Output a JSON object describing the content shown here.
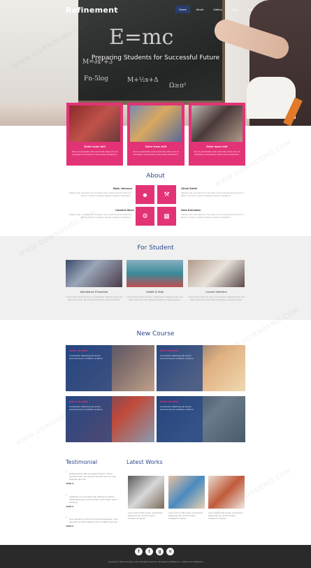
{
  "header": {
    "brand": "Refinement",
    "nav": [
      "Home",
      "About",
      "Gallery",
      "Typo",
      "Mail"
    ],
    "tagline": "Preparing Students for Successful Future"
  },
  "hero_board": {
    "formula": "E=mc",
    "lines": [
      "M=∂x²+3",
      "Fn-5log",
      "M+½x+Δ",
      "Ω≥π²"
    ]
  },
  "features": [
    {
      "title": "Dolor isusc tulit",
      "desc": "Sed ut perspiciatis unde omnis iste natus error sit voluptatem accusantium doloremque laudantium."
    },
    {
      "title": "Dolor isusc tulit",
      "desc": "Sed ut perspiciatis unde omnis iste natus error sit voluptatem accusantium doloremque laudantium."
    },
    {
      "title": "Dolor isusc tulit",
      "desc": "Sed ut perspiciatis unde omnis iste natus error sit voluptatem accusantium doloremque laudantium."
    }
  ],
  "about": {
    "title": "About",
    "people": [
      {
        "name": "Mark Johnson",
        "text": "Adipisci velit, sed quia non numquam eius modi tempora incidunt ut labore et dolore magnam aliquam quaerat voluptatem."
      },
      {
        "name": "Olivia Smith",
        "text": "Adipisci velit, sed quia non numquam eius modi tempora incidunt ut labore et dolore magnam aliquam quaerat voluptatem."
      },
      {
        "name": "Caroline Beek",
        "text": "Adipisci velit, sed quia non numquam eius modi tempora incidunt ut labore et dolore magnam aliquam quaerat voluptatem."
      },
      {
        "name": "Sara Kinnistan",
        "text": "Adipisci velit, sed quia non numquam eius modi tempora incidunt ut labore et dolore magnam aliquam quaerat voluptatem."
      }
    ]
  },
  "student": {
    "title": "For Student",
    "items": [
      {
        "title": "Attendance Procedure",
        "desc": "Lorem ipsum dolor sit amet, consectetuer adipiscing elit, sed diam nonummy nibh euismod tincidunt ut laoreet dolore."
      },
      {
        "title": "Health & Help",
        "desc": "Lorem ipsum dolor sit amet, consectetuer adipiscing elit, sed diam nonummy nibh euismod tincidunt ut laoreet dolore."
      },
      {
        "title": "Course Selection",
        "desc": "Lorem ipsum dolor sit amet, consectetuer adipiscing elit, sed diam nonummy nibh euismod tincidunt ut laoreet dolore."
      }
    ]
  },
  "courses": {
    "title": "New Course",
    "items": [
      {
        "title": "Dolor sit amet",
        "desc": "Consectetur adipiscing elit sed do eiusmod tempor incididunt ut labore."
      },
      {
        "title": "Dolor sit amet",
        "desc": "Consectetur adipiscing elit sed do eiusmod tempor incididunt ut labore."
      },
      {
        "title": "Dolor sit amet",
        "desc": "Consectetur adipiscing elit sed do eiusmod tempor incididunt ut labore."
      },
      {
        "title": "Dolor sit amet",
        "desc": "Consectetur adipiscing elit sed do eiusmod tempor incididunt ut labore."
      }
    ]
  },
  "testimonial": {
    "title": "Testimonial",
    "quotes": [
      {
        "text": "Quisque lacus, felis ac feugiat interdum. Morbi hendrerit dolor nec pulvinar hendrerit arcu ac risus. Praesent quis nisl.",
        "author": "JOHN S."
      },
      {
        "text": "Vestibulum et consequat velit. Maecenas ultrices malesuada lacus porta hendrerit, sed in diam auctor hendrerit.",
        "author": "JOHN S."
      },
      {
        "text": "Cras interdum ut purus id rhoncus scelerisque. Cras eget felis ut turpis sodales luctus. Curabitur sed nisl.",
        "author": "JOHN S."
      }
    ]
  },
  "latest_works": {
    "title": "Latest Works",
    "items": [
      {
        "desc": "Lorem ipsum dolor amet, consectetur adipiscing elit, sed do tempor incididunt ut labore."
      },
      {
        "desc": "Lorem ipsum dolor amet, consectetur adipiscing elit, sed do tempor incididunt ut labore."
      },
      {
        "desc": "Lorem ipsum dolor amet, consectetur adipiscing elit, sed do tempor incididunt ut labore."
      }
    ]
  },
  "footer": {
    "social": [
      "f",
      "t",
      "g",
      "v"
    ],
    "copyright": "Copyright © 2014 Company name All rights reserved. Template by W3layouts · Collect from W3layouts"
  },
  "watermark": "WWW.DOWNDEMO.COM",
  "colors": {
    "accent": "#e33377",
    "heading": "#2a4a8a",
    "nav_active": "#2a3d6e",
    "footer": "#2a2a2a"
  }
}
